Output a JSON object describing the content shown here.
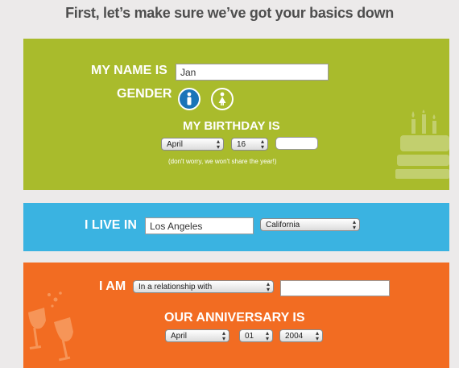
{
  "page": {
    "title": "First, let’s make sure we’ve got your basics down"
  },
  "basics": {
    "name_label": "MY NAME IS",
    "name_value": "Jan",
    "gender_label": "GENDER",
    "gender_options": [
      "male-icon",
      "female-icon"
    ],
    "gender_selected": "male",
    "birthday_label": "MY BIRTHDAY IS",
    "birth_month": "April",
    "birth_day": "16",
    "birth_year": "",
    "privacy_note": "(don't worry, we won't share the year!)",
    "decor_icon": "birthday-cake-icon"
  },
  "location": {
    "label": "I LIVE IN",
    "city_value": "Los Angeles",
    "state": "California"
  },
  "relationship": {
    "label": "I AM",
    "status": "In a relationship with",
    "partner_value": "",
    "anniversary_label": "OUR ANNIVERSARY IS",
    "anniv_month": "April",
    "anniv_day": "01",
    "anniv_year": "2004",
    "decor_icon": "champagne-glasses-icon"
  },
  "colors": {
    "green_panel": "#a9bb2c",
    "blue_panel": "#3ab3e1",
    "orange_panel": "#f26c22",
    "male_selected": "#1a74b8"
  }
}
